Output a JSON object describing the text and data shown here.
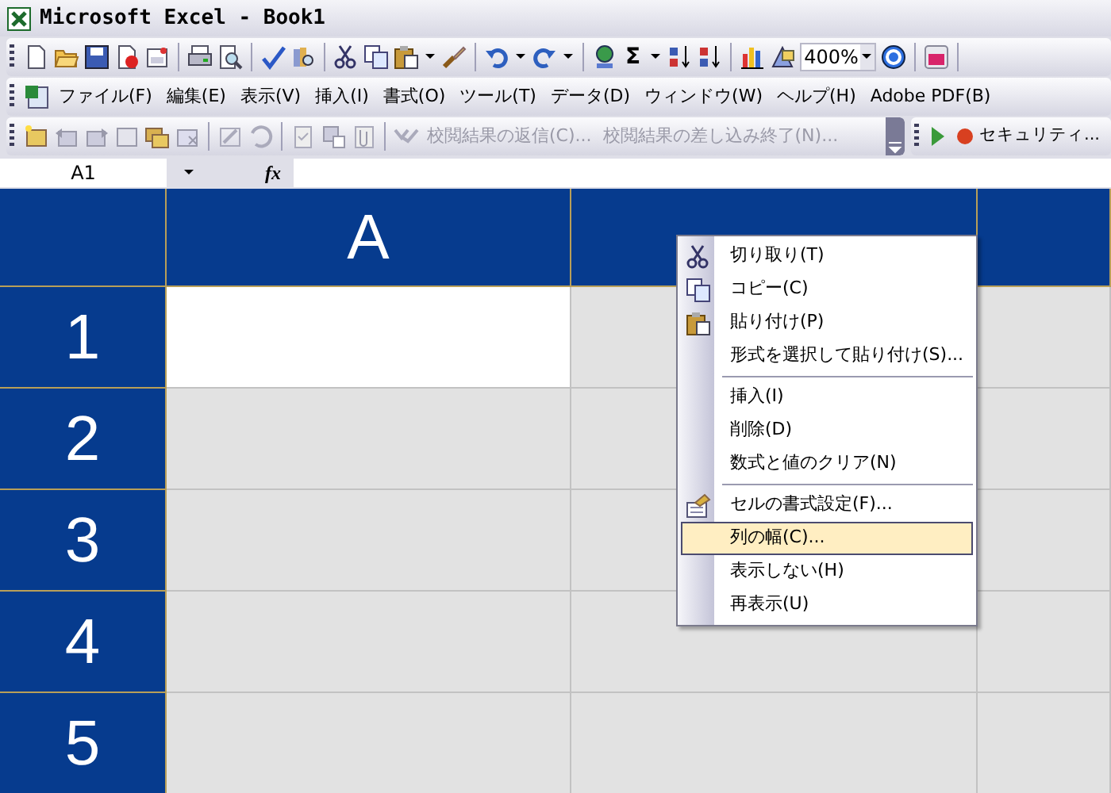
{
  "window": {
    "title": "Microsoft Excel - Book1"
  },
  "standard_toolbar": {
    "sum_symbol": "Σ",
    "zoom": "400%"
  },
  "menu_bar": [
    "ファイル(F)",
    "編集(E)",
    "表示(V)",
    "挿入(I)",
    "書式(O)",
    "ツール(T)",
    "データ(D)",
    "ウィンドウ(W)",
    "ヘルプ(H)",
    "Adobe PDF(B)"
  ],
  "reviewing_toolbar": {
    "buttons": [
      {
        "label": "校閲結果の返信(C)...",
        "disabled": true
      },
      {
        "label": "校閲結果の差し込み終了(N)...",
        "disabled": true
      }
    ]
  },
  "security_toolbar": {
    "label": "セキュリティ..."
  },
  "formula_bar": {
    "name_box": "A1",
    "fx": "fx"
  },
  "sheet": {
    "column_headers": [
      "A"
    ],
    "rows": [
      "1",
      "2",
      "3",
      "4",
      "5"
    ]
  },
  "context_menu": {
    "items": [
      {
        "label": "切り取り(T)",
        "selected": false,
        "separator_before": false
      },
      {
        "label": "コピー(C)",
        "selected": false,
        "separator_before": false
      },
      {
        "label": "貼り付け(P)",
        "selected": false,
        "separator_before": false
      },
      {
        "label": "形式を選択して貼り付け(S)...",
        "selected": false,
        "separator_before": false
      },
      {
        "label": "挿入(I)",
        "selected": false,
        "separator_before": true
      },
      {
        "label": "削除(D)",
        "selected": false,
        "separator_before": false
      },
      {
        "label": "数式と値のクリア(N)",
        "selected": false,
        "separator_before": false
      },
      {
        "label": "セルの書式設定(F)...",
        "selected": false,
        "separator_before": true
      },
      {
        "label": "列の幅(C)...",
        "selected": true,
        "separator_before": false
      },
      {
        "label": "表示しない(H)",
        "selected": false,
        "separator_before": false
      },
      {
        "label": "再表示(U)",
        "selected": false,
        "separator_before": false
      }
    ]
  }
}
